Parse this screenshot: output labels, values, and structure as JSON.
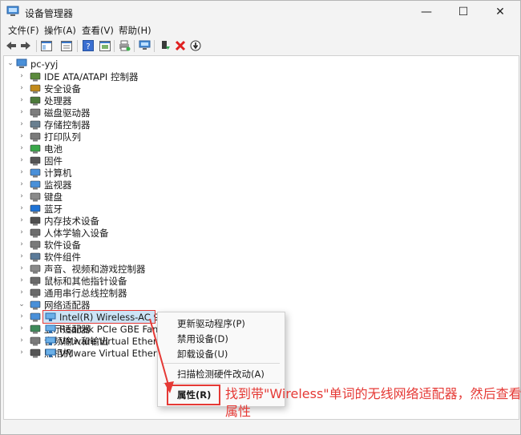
{
  "window": {
    "title": "设备管理器",
    "controls": {
      "minimize": "—",
      "maximize": "☐",
      "close": "✕"
    }
  },
  "menubar": [
    "文件(F)",
    "操作(A)",
    "查看(V)",
    "帮助(H)"
  ],
  "tree": {
    "root": "pc-yyj",
    "categories": [
      {
        "label": "IDE ATA/ATAPI 控制器",
        "icon": "ide-controller-icon",
        "expanded": false
      },
      {
        "label": "安全设备",
        "icon": "security-device-icon",
        "expanded": false
      },
      {
        "label": "处理器",
        "icon": "processor-icon",
        "expanded": false
      },
      {
        "label": "磁盘驱动器",
        "icon": "disk-drive-icon",
        "expanded": false
      },
      {
        "label": "存储控制器",
        "icon": "storage-controller-icon",
        "expanded": false
      },
      {
        "label": "打印队列",
        "icon": "printer-icon",
        "expanded": false
      },
      {
        "label": "电池",
        "icon": "battery-icon",
        "expanded": false
      },
      {
        "label": "固件",
        "icon": "firmware-icon",
        "expanded": false
      },
      {
        "label": "计算机",
        "icon": "computer-icon",
        "expanded": false
      },
      {
        "label": "监视器",
        "icon": "monitor-icon",
        "expanded": false
      },
      {
        "label": "键盘",
        "icon": "keyboard-icon",
        "expanded": false
      },
      {
        "label": "蓝牙",
        "icon": "bluetooth-icon",
        "expanded": false
      },
      {
        "label": "内存技术设备",
        "icon": "memory-device-icon",
        "expanded": false
      },
      {
        "label": "人体学输入设备",
        "icon": "hid-icon",
        "expanded": false
      },
      {
        "label": "软件设备",
        "icon": "software-device-icon",
        "expanded": false
      },
      {
        "label": "软件组件",
        "icon": "software-component-icon",
        "expanded": false
      },
      {
        "label": "声音、视频和游戏控制器",
        "icon": "audio-icon",
        "expanded": false
      },
      {
        "label": "鼠标和其他指针设备",
        "icon": "mouse-icon",
        "expanded": false
      },
      {
        "label": "通用串行总线控制器",
        "icon": "usb-icon",
        "expanded": false
      },
      {
        "label": "网络适配器",
        "icon": "network-adapter-icon",
        "expanded": true
      },
      {
        "label": "系统设备",
        "icon": "system-device-icon",
        "expanded": false
      },
      {
        "label": "显示适配器",
        "icon": "display-adapter-icon",
        "expanded": false
      },
      {
        "label": "音频输入和输出",
        "icon": "audio-io-icon",
        "expanded": false
      },
      {
        "label": "照相机",
        "icon": "camera-icon",
        "expanded": false
      }
    ],
    "network_adapters": [
      "Intel(R) Wireless-AC 9462",
      "Realtek PCIe GBE Family C",
      "VMware Virtual Ethernet A",
      "VMware Virtual Ethernet A"
    ]
  },
  "context_menu": {
    "items": [
      "更新驱动程序(P)",
      "禁用设备(D)",
      "卸载设备(U)",
      "扫描检测硬件改动(A)",
      "属性(R)"
    ]
  },
  "annotation": {
    "text": "找到带\"Wireless\"单词的无线网络适配器，然后查看属性",
    "color": "#e53935"
  }
}
